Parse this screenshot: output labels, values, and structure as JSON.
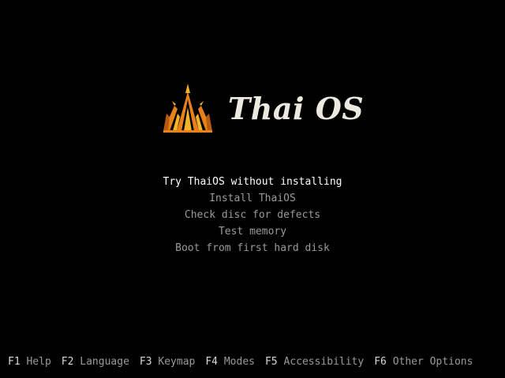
{
  "logo": {
    "text": "Thai OS",
    "icon": "temple-roof-icon",
    "colors": {
      "orange": "#e8811a",
      "gold": "#f5b32a",
      "dark_orange": "#b85a10"
    }
  },
  "menu": {
    "selected_index": 0,
    "items": [
      {
        "label": "Try ThaiOS without installing"
      },
      {
        "label": "Install ThaiOS"
      },
      {
        "label": "Check disc for defects"
      },
      {
        "label": "Test memory"
      },
      {
        "label": "Boot from first hard disk"
      }
    ]
  },
  "footer": {
    "keys": [
      {
        "key": "F1",
        "label": "Help"
      },
      {
        "key": "F2",
        "label": "Language"
      },
      {
        "key": "F3",
        "label": "Keymap"
      },
      {
        "key": "F4",
        "label": "Modes"
      },
      {
        "key": "F5",
        "label": "Accessibility"
      },
      {
        "key": "F6",
        "label": "Other Options"
      }
    ]
  },
  "colors": {
    "background": "#000000",
    "menu_text": "#9a9a9a",
    "menu_selected": "#ffffff"
  }
}
